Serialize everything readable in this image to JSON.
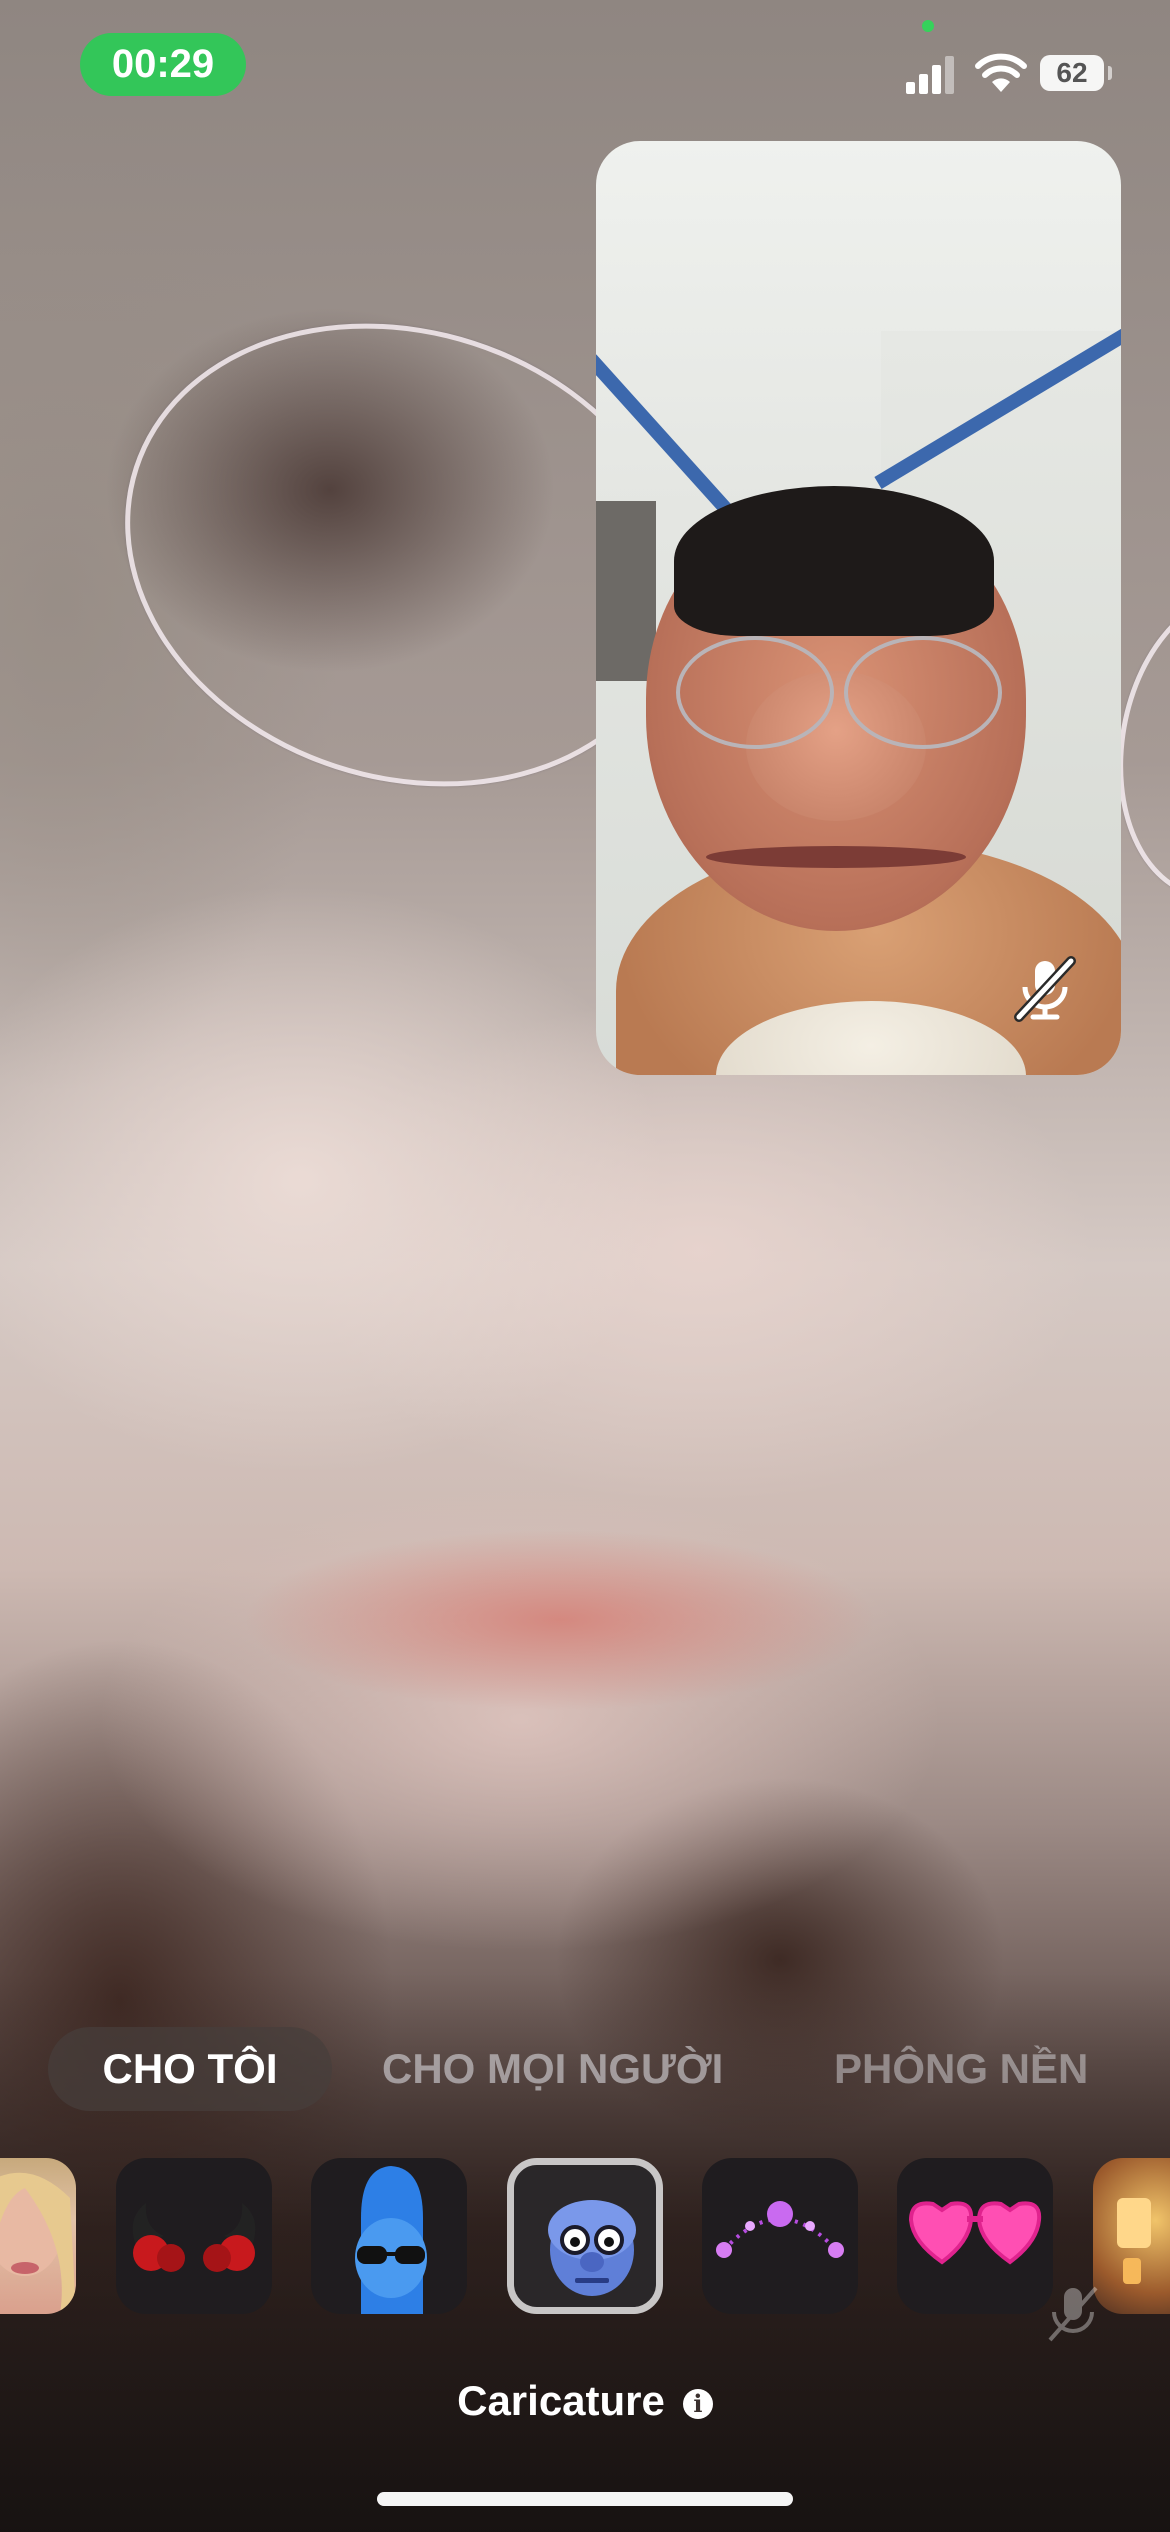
{
  "status_bar": {
    "call_timer": "00:29",
    "battery_level": "62",
    "camera_indicator_color": "#35d25b",
    "timer_color": "#33c659"
  },
  "self_view": {
    "mic_status_icon": "mic-slash-icon"
  },
  "effects": {
    "tabs": [
      {
        "label": "CHO TÔI",
        "active": true
      },
      {
        "label": "CHO MỌI NGƯỜI",
        "active": false
      },
      {
        "label": "PHÔNG NỀN",
        "active": false
      }
    ],
    "tiles": [
      {
        "icon": "portrait-photo-icon"
      },
      {
        "icon": "devil-horns-icon"
      },
      {
        "icon": "blue-alien-memoji-icon"
      },
      {
        "icon": "caricature-face-icon",
        "selected": true
      },
      {
        "icon": "purple-tiara-icon"
      },
      {
        "icon": "heart-glasses-icon"
      },
      {
        "icon": "lantern-icon"
      }
    ],
    "selected_effect_name": "Caricature",
    "info_glyph": "i"
  }
}
